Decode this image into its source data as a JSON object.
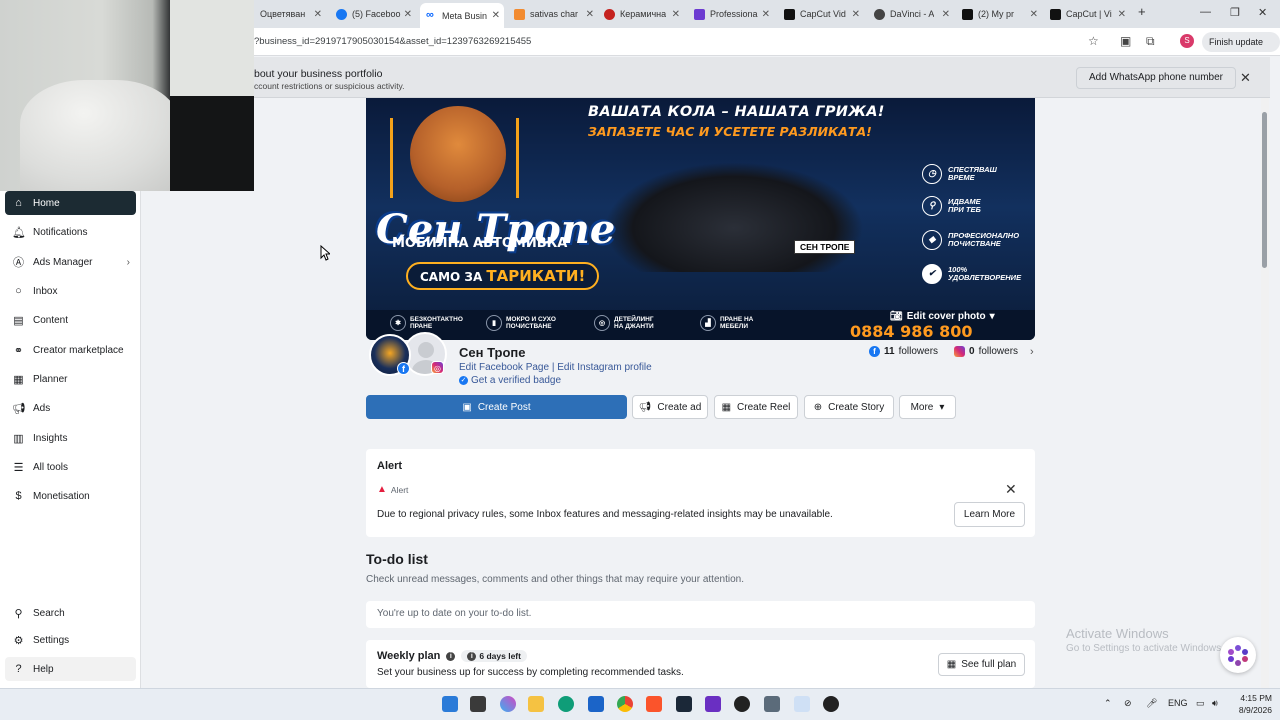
{
  "browser": {
    "tabs": [
      {
        "label": "Оцветяван",
        "color": "#5f6368",
        "active": false
      },
      {
        "label": "(5) Faceboo",
        "color": "#1877f2",
        "active": false
      },
      {
        "label": "Meta Busin",
        "color": "#0866ff",
        "active": true
      },
      {
        "label": "sativas char",
        "color": "#f28b30",
        "active": false
      },
      {
        "label": "Керамична",
        "color": "#c5221f",
        "active": false
      },
      {
        "label": "Professiona",
        "color": "#6c3bd1",
        "active": false
      },
      {
        "label": "CapCut Vid",
        "color": "#111111",
        "active": false
      },
      {
        "label": "DaVinci - A",
        "color": "#444444",
        "active": false
      },
      {
        "label": "(2) My pr",
        "color": "#111111",
        "active": false
      },
      {
        "label": "CapCut | Vi",
        "color": "#111111",
        "active": false
      }
    ],
    "url": "?business_id=2919717905030154&asset_id=1239763269215455",
    "profile_initial": "S",
    "finish_update_label": "Finish update"
  },
  "banner": {
    "title": "bout your business portfolio",
    "subtitle": "ccount restrictions or suspicious activity.",
    "whatsapp_label": "Add WhatsApp phone number"
  },
  "sidebar": {
    "items": [
      {
        "label": "Home",
        "icon": "home-icon"
      },
      {
        "label": "Notifications",
        "icon": "bell-icon"
      },
      {
        "label": "Ads Manager",
        "icon": "ads-manager-icon"
      },
      {
        "label": "Inbox",
        "icon": "chat-icon"
      },
      {
        "label": "Content",
        "icon": "content-icon"
      },
      {
        "label": "Creator marketplace",
        "icon": "handshake-icon"
      },
      {
        "label": "Planner",
        "icon": "calendar-icon"
      },
      {
        "label": "Ads",
        "icon": "megaphone-icon"
      },
      {
        "label": "Insights",
        "icon": "chart-icon"
      },
      {
        "label": "All tools",
        "icon": "menu-icon"
      },
      {
        "label": "Monetisation",
        "icon": "dollar-icon"
      }
    ],
    "bottom": [
      {
        "label": "Search",
        "icon": "search-icon"
      },
      {
        "label": "Settings",
        "icon": "gear-icon"
      },
      {
        "label": "Help",
        "icon": "help-icon"
      }
    ]
  },
  "cover": {
    "headline": "ВАШАТА КОЛА – НАШАТА ГРИЖА!",
    "subline": "ЗАПАЗЕТЕ ЧАС И УСЕТЕТЕ РАЗЛИКАТА!",
    "brand": "Сен Тропе",
    "mobile": "МОБИЛНА АВТОМИВКА",
    "samo_prefix": "САМО ЗА",
    "samo_word": "ТАРИКАТИ!",
    "plate": "СЕН ТРОПЕ",
    "features": [
      {
        "line1": "СПЕСТЯВАШ",
        "line2": "ВРЕМЕ"
      },
      {
        "line1": "ИДВАМЕ",
        "line2": "ПРИ ТЕБ"
      },
      {
        "line1": "ПРОФЕСИОНАЛНО",
        "line2": "ПОЧИСТВАНЕ"
      },
      {
        "line1": "100%",
        "line2": "УДОВЛЕТВОРЕНИЕ"
      }
    ],
    "strip": [
      {
        "line1": "БЕЗКОНТАКТНО",
        "line2": "ПРАНЕ"
      },
      {
        "line1": "МОКРО И СУХО",
        "line2": "ПОЧИСТВАНЕ"
      },
      {
        "line1": "ДЕТЕЙЛИНГ",
        "line2": "НА ДЖАНТИ"
      },
      {
        "line1": "ПРАНЕ НА",
        "line2": "МЕБЕЛИ"
      }
    ],
    "phone": "0884 986 800",
    "edit_cover_label": "Edit cover photo"
  },
  "page": {
    "name": "Сен Тропе",
    "edit_links": "Edit Facebook Page | Edit Instagram profile",
    "verified_label": "Get a verified badge",
    "fb_followers_count": "11",
    "fb_followers_label": "followers",
    "ig_followers_count": "0",
    "ig_followers_label": "followers"
  },
  "actions": {
    "create_post": "Create Post",
    "create_ad": "Create ad",
    "create_reel": "Create Reel",
    "create_story": "Create Story",
    "more": "More"
  },
  "alert": {
    "title": "Alert",
    "sub": "Alert",
    "body": "Due to regional privacy rules, some Inbox features and messaging-related insights may be unavailable.",
    "learn_more": "Learn More"
  },
  "todo": {
    "title": "To-do list",
    "sub": "Check unread messages, comments and other things that may require your attention.",
    "empty": "You're up to date on your to-do list."
  },
  "weekly": {
    "title": "Weekly plan",
    "days_left": "6 days left",
    "sub": "Set your business up for success by completing recommended tasks.",
    "see_full_plan": "See full plan"
  },
  "watermark": {
    "line1": "Activate Windows",
    "line2": "Go to Settings to activate Windows."
  },
  "taskbar": {
    "lang": "ENG",
    "time": "4:15 PM",
    "date": "8/9/2026"
  }
}
